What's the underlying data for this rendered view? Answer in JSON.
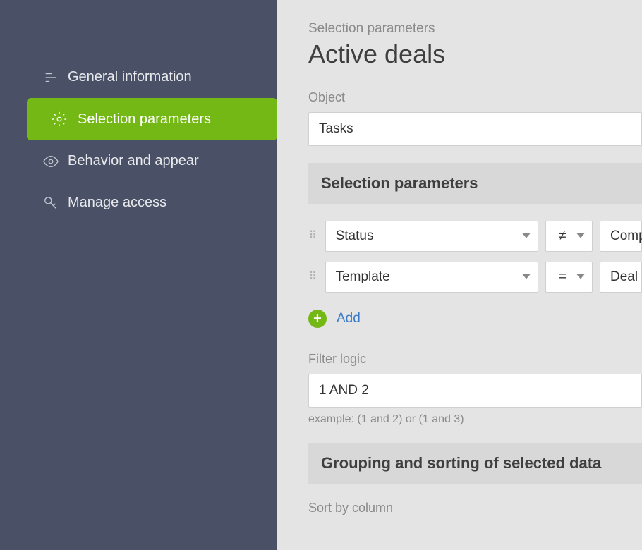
{
  "sidebar": {
    "items": [
      {
        "label": "General information"
      },
      {
        "label": "Selection parameters"
      },
      {
        "label": "Behavior and appear"
      },
      {
        "label": "Manage access"
      }
    ]
  },
  "breadcrumb": "Selection parameters",
  "page_title": "Active deals",
  "object_label": "Object",
  "object_value": "Tasks",
  "section_selection": "Selection parameters",
  "filters": [
    {
      "field": "Status",
      "op": "≠",
      "value": "Comp"
    },
    {
      "field": "Template",
      "op": "=",
      "value": "Deal"
    }
  ],
  "add_label": "Add",
  "filter_logic_label": "Filter logic",
  "filter_logic_value": "1 AND 2",
  "filter_logic_example": "example: (1 and 2) or (1 and 3)",
  "section_grouping": "Grouping and sorting of selected data",
  "sort_by_label": "Sort by column"
}
